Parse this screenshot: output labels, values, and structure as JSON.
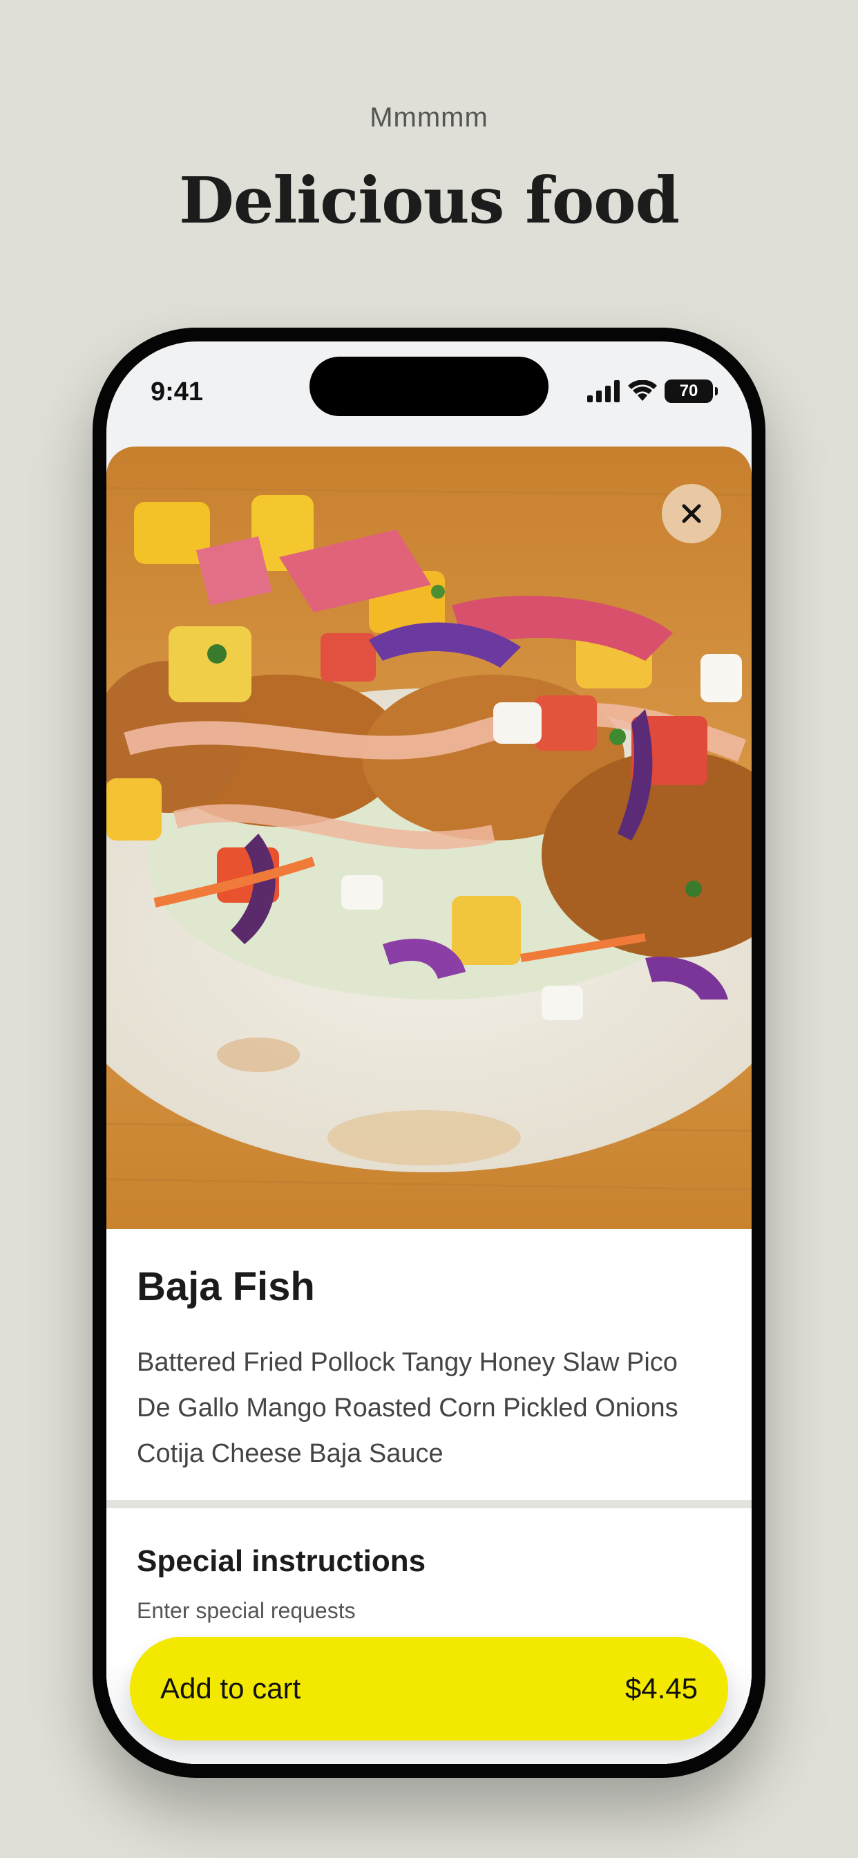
{
  "page": {
    "eyebrow": "Mmmmm",
    "headline": "Delicious food"
  },
  "status_bar": {
    "time": "9:41",
    "battery": "70"
  },
  "item": {
    "name": "Baja Fish",
    "description": "Battered Fried Pollock Tangy Honey Slaw Pico De Gallo Mango Roasted Corn Pickled Onions Cotija Cheese Baja Sauce",
    "photo_icon": "food-photo"
  },
  "instructions": {
    "title": "Special instructions",
    "placeholder": "Enter special requests"
  },
  "cart": {
    "label": "Add to cart",
    "price": "$4.45"
  },
  "colors": {
    "background": "#dfdfd7",
    "accent": "#f2e800",
    "close_button": "#e8c9a3"
  }
}
